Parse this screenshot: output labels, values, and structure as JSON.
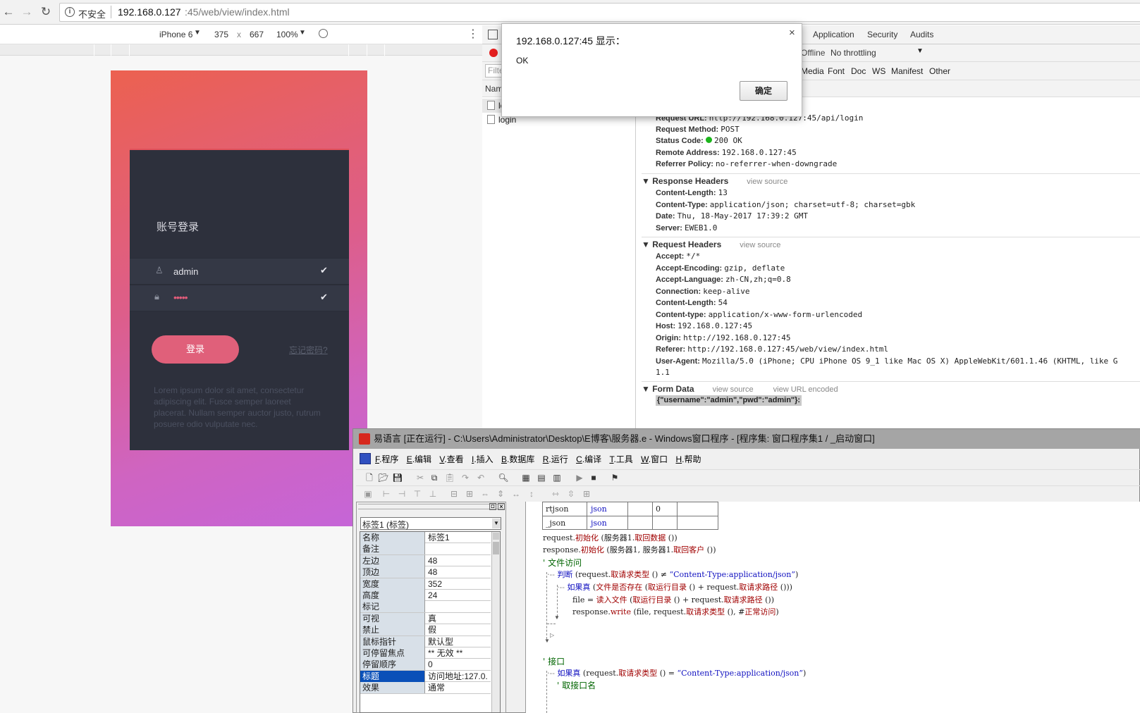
{
  "browser": {
    "back_icon": "←",
    "forward_icon": "→",
    "reload_icon": "↻",
    "security_label": "不安全",
    "url_host": "192.168.0.127",
    "url_rest": ":45/web/view/index.html"
  },
  "device_toolbar": {
    "device": "iPhone 6",
    "width": "375",
    "x": "x",
    "height": "667",
    "zoom": "100%"
  },
  "login_page": {
    "title": "账号登录",
    "username": "admin",
    "password_dots": "•••••",
    "login_button": "登录",
    "forgot_link": "忘记密码?",
    "lorem": "Lorem ipsum dolor sit amet, consectetur adipiscing elit. Fusce semper laoreet placerat. Nullam semper auctor justo, rutrum posuere odio vulputate nec."
  },
  "devtools": {
    "tabs": [
      "Application",
      "Security",
      "Audits"
    ],
    "offline": "Offline",
    "throttling": "No throttling",
    "filter_placeholder": "Filter",
    "filter_types": [
      "Media",
      "Font",
      "Doc",
      "WS",
      "Manifest",
      "Other"
    ],
    "name_header": "Name",
    "requests": [
      "login",
      "login"
    ],
    "general": [
      {
        "k": "Request URL:",
        "v": "http://192.168.0.127:45/api/login"
      },
      {
        "k": "Request Method:",
        "v": "POST"
      },
      {
        "k": "Status Code:",
        "v": "200 OK"
      },
      {
        "k": "Remote Address:",
        "v": "192.168.0.127:45"
      },
      {
        "k": "Referrer Policy:",
        "v": "no-referrer-when-downgrade"
      }
    ],
    "response_headers_title": "Response Headers",
    "view_source": "view source",
    "response_headers": [
      {
        "k": "Content-Length:",
        "v": "13"
      },
      {
        "k": "Content-Type:",
        "v": "application/json; charset=utf-8; charset=gbk"
      },
      {
        "k": "Date:",
        "v": "Thu, 18-May-2017 17:39:2 GMT"
      },
      {
        "k": "Server:",
        "v": "EWEB1.0"
      }
    ],
    "request_headers_title": "Request Headers",
    "request_headers": [
      {
        "k": "Accept:",
        "v": "*/*"
      },
      {
        "k": "Accept-Encoding:",
        "v": "gzip, deflate"
      },
      {
        "k": "Accept-Language:",
        "v": "zh-CN,zh;q=0.8"
      },
      {
        "k": "Connection:",
        "v": "keep-alive"
      },
      {
        "k": "Content-Length:",
        "v": "54"
      },
      {
        "k": "Content-type:",
        "v": "application/x-www-form-urlencoded"
      },
      {
        "k": "Host:",
        "v": "192.168.0.127:45"
      },
      {
        "k": "Origin:",
        "v": "http://192.168.0.127:45"
      },
      {
        "k": "Referer:",
        "v": "http://192.168.0.127:45/web/view/index.html"
      },
      {
        "k": "User-Agent:",
        "v": "Mozilla/5.0 (iPhone; CPU iPhone OS 9_1 like Mac OS X) AppleWebKit/601.1.46 (KHTML, like G"
      }
    ],
    "ua_wrap": "1.1",
    "form_data_title": "Form Data",
    "view_url_encoded": "view URL encoded",
    "form_data": "{\"username\":\"admin\",\"pwd\":\"admin\"}:"
  },
  "alert": {
    "title": "192.168.0.127:45 显示：",
    "message": "OK",
    "ok_button": "确定",
    "close": "×"
  },
  "ide": {
    "title": "易语言 [正在运行] - C:\\Users\\Administrator\\Desktop\\E博客\\服务器.e - Windows窗口程序 - [程序集: 窗口程序集1 / _启动窗口]",
    "menu": [
      {
        "key": "F",
        "label": ".程序"
      },
      {
        "key": "E",
        "label": ".编辑"
      },
      {
        "key": "V",
        "label": ".查看"
      },
      {
        "key": "I",
        "label": ".插入"
      },
      {
        "key": "B",
        "label": ".数据库"
      },
      {
        "key": "R",
        "label": ".运行"
      },
      {
        "key": "C",
        "label": ".编译"
      },
      {
        "key": "T",
        "label": ".工具"
      },
      {
        "key": "W",
        "label": ".窗口"
      },
      {
        "key": "H",
        "label": ".帮助"
      }
    ],
    "component_select": "标签1 (标签)",
    "props": [
      {
        "n": "名称",
        "v": "标签1"
      },
      {
        "n": "备注",
        "v": ""
      },
      {
        "n": "左边",
        "v": "48"
      },
      {
        "n": "顶边",
        "v": "48"
      },
      {
        "n": "宽度",
        "v": "352"
      },
      {
        "n": "高度",
        "v": "24"
      },
      {
        "n": "标记",
        "v": ""
      },
      {
        "n": "可视",
        "v": "真"
      },
      {
        "n": "禁止",
        "v": "假"
      },
      {
        "n": "鼠标指针",
        "v": "默认型"
      },
      {
        "n": "可停留焦点",
        "v": "** 无效 **"
      },
      {
        "n": "  停留顺序",
        "v": "0"
      },
      {
        "n": "标题",
        "v": "访问地址:127.0."
      },
      {
        "n": "效果",
        "v": "通常"
      }
    ],
    "vars": [
      {
        "name": "rtjson",
        "type": "json",
        "c3": "",
        "c4": "0"
      },
      {
        "name": "_json",
        "type": "json",
        "c3": "",
        "c4": ""
      }
    ]
  }
}
